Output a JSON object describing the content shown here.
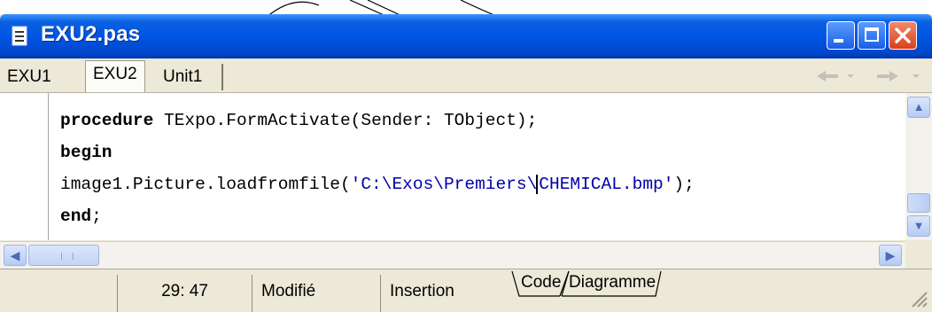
{
  "window": {
    "title": "EXU2.pas"
  },
  "tabs": [
    {
      "label": "EXU1",
      "active": false
    },
    {
      "label": "EXU2",
      "active": true
    },
    {
      "label": "Unit1",
      "active": false
    }
  ],
  "nav": {
    "back_icon": "arrow-left-icon",
    "forward_icon": "arrow-right-icon",
    "dropdown_icon": "chevron-down-icon"
  },
  "code": {
    "line1_keyword": "procedure",
    "line1_rest": " TExpo.FormActivate(Sender: TObject);",
    "line2_keyword": "begin",
    "line3_prefix": "image1.Picture.loadfromfile(",
    "line3_string_a": "'C:\\Exos\\Premiers\\",
    "line3_string_b": "CHEMICAL.bmp'",
    "line3_suffix": ");",
    "line4_keyword": "end",
    "line4_suffix": ";"
  },
  "status": {
    "position": "29:  47",
    "modified": "Modifié",
    "mode": "Insertion",
    "tab_code": "Code",
    "tab_diagram": "Diagramme"
  },
  "colors": {
    "titlebar": "#0055e5",
    "string": "#0000aa",
    "close_button": "#d9401c"
  }
}
